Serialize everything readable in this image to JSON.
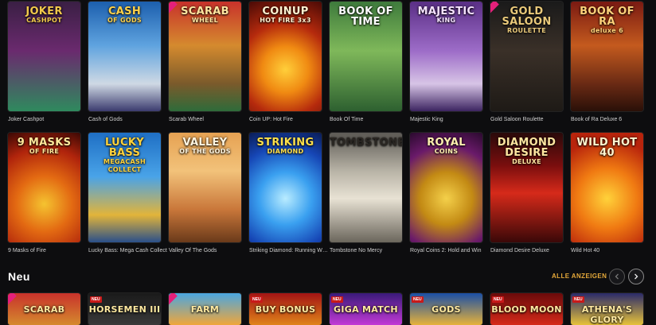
{
  "row1": [
    {
      "name": "Joker Cashpot",
      "logo": "JOKER",
      "sub": "CASHPOT",
      "badge": "",
      "bg": "linear-gradient(180deg,#3a1f44 0%,#6a2a6e 45%,#2f8a5e 100%)",
      "logo_color": "#f2c94c"
    },
    {
      "name": "Cash of Gods",
      "logo": "CASH",
      "sub": "OF GODS",
      "badge": "",
      "bg": "linear-gradient(180deg,#1c5fae 0%,#5fa3df 40%,#cfd9e4 75%,#3b3b6e 100%)",
      "logo_color": "#ffd24a"
    },
    {
      "name": "Scarab Wheel",
      "logo": "SCARAB",
      "sub": "WHEEL",
      "badge": "ribbon",
      "bg": "linear-gradient(180deg,#c8322b 0%,#d58a2e 40%,#7a5a2b 75%,#2e6b3a 100%)",
      "logo_color": "#ffe6a0"
    },
    {
      "name": "Coin UP: Hot Fire",
      "logo": "COINUP",
      "sub": "HOT FIRE 3x3",
      "badge": "",
      "bg": "radial-gradient(circle at 50% 62%,#ffcf3a 0%,#f08a12 30%,#b52a0d 60%,#4a0a06 100%)",
      "logo_color": "#fff1d0"
    },
    {
      "name": "Book Of Time",
      "logo": "BOOK OF TIME",
      "sub": "",
      "badge": "",
      "bg": "linear-gradient(180deg,#3e7a3c 0%,#7fb85a 45%,#2d6030 100%)",
      "logo_color": "#ffffff"
    },
    {
      "name": "Majestic King",
      "logo": "MAJESTIC",
      "sub": "KING",
      "badge": "",
      "bg": "linear-gradient(180deg,#5a2f86 0%,#9d6cc8 45%,#d7c4e6 75%,#3c2460 100%)",
      "logo_color": "#f5e2ff"
    },
    {
      "name": "Gold Saloon Roulette",
      "logo": "GOLD SALOON",
      "sub": "ROULETTE",
      "badge": "ribbon",
      "bg": "linear-gradient(180deg,#1a1a1a 0%,#3a3028 45%,#1e1a16 100%)",
      "logo_color": "#e9c97a"
    },
    {
      "name": "Book of Ra Deluxe 6",
      "logo": "BOOK OF RA",
      "sub": "deluxe 6",
      "badge": "",
      "bg": "linear-gradient(180deg,#7a1a12 0%,#c45a1e 40%,#6a2a14 75%,#2a1008 100%)",
      "logo_color": "#ffd27a"
    }
  ],
  "row2": [
    {
      "name": "9 Masks of Fire",
      "logo": "9 MASKS",
      "sub": "OF FIRE",
      "badge": "",
      "bg": "radial-gradient(circle at 50% 65%,#f5c330 0%,#e36a12 35%,#b0240c 70%,#3a0804 100%)",
      "logo_color": "#ffe89a"
    },
    {
      "name": "Lucky Bass: Mega Cash Collect",
      "logo": "LUCKY BASS",
      "sub": "MEGACASH COLLECT",
      "badge": "",
      "bg": "linear-gradient(180deg,#1f6fc4 0%,#49a3e8 40%,#e2b43a 75%,#2a4f8a 100%)",
      "logo_color": "#ffd23a"
    },
    {
      "name": "Valley Of The Gods",
      "logo": "VALLEY",
      "sub": "OF THE GODS",
      "badge": "",
      "bg": "linear-gradient(180deg,#e6a253 0%,#f2c27a 35%,#c9773a 70%,#6a3a1a 100%)",
      "logo_color": "#fff6e2"
    },
    {
      "name": "Striking Diamond: Running Wins",
      "logo": "STRIKING",
      "sub": "DIAMOND",
      "badge": "",
      "bg": "radial-gradient(circle at 50% 60%,#b9ecff 0%,#3aa0f0 35%,#1646b5 70%,#0a1c55 100%)",
      "logo_color": "#ffe04a"
    },
    {
      "name": "Tombstone No Mercy",
      "logo": "TOMBSTONE",
      "sub": "",
      "badge": "",
      "bg": "linear-gradient(180deg,#5d5a55 0%,#b8b3a6 35%,#e8e2d4 60%,#6b665c 100%)",
      "logo_color": "#2a2622"
    },
    {
      "name": "Royal Coins 2: Hold and Win",
      "logo": "ROYAL",
      "sub": "COINS",
      "badge": "",
      "bg": "radial-gradient(circle at 50% 60%,#f4d04a 0%,#c38a14 35%,#6a1a6a 70%,#2a0a2e 100%)",
      "logo_color": "#fff0b0"
    },
    {
      "name": "Diamond Desire Deluxe",
      "logo": "DIAMOND DESIRE",
      "sub": "DELUXE",
      "badge": "",
      "bg": "linear-gradient(180deg,#2a0a0a 0%,#7a0e0e 30%,#d62a1a 55%,#3a0808 100%)",
      "logo_color": "#ffe6a0"
    },
    {
      "name": "Wild Hot 40",
      "logo": "WILD HOT 40",
      "sub": "",
      "badge": "",
      "bg": "radial-gradient(circle at 50% 60%,#ffd23a 0%,#f07a12 40%,#b8240c 80%)",
      "logo_color": "#fff6d0"
    }
  ],
  "section": {
    "title": "Neu",
    "show_all": "ALLE ANZEIGEN"
  },
  "new_row": [
    {
      "logo": "SCARAB",
      "badge": "ribbon",
      "tag": "",
      "bg": "linear-gradient(180deg,#c8322b,#d58a2e)"
    },
    {
      "logo": "HORSEMEN III",
      "badge": "",
      "tag": "NEU",
      "bg": "linear-gradient(180deg,#1a1a1a,#3a3a3a)"
    },
    {
      "logo": "FARM",
      "badge": "ribbon",
      "tag": "",
      "bg": "linear-gradient(180deg,#4aa6e0,#f0a63a)"
    },
    {
      "logo": "BUY BONUS",
      "badge": "",
      "tag": "NEU",
      "bg": "linear-gradient(180deg,#a31414,#e0841a)"
    },
    {
      "logo": "GIGA MATCH",
      "badge": "",
      "tag": "NEU",
      "bg": "linear-gradient(180deg,#3a1a7a,#c23ad6)"
    },
    {
      "logo": "GODS",
      "badge": "",
      "tag": "NEU",
      "bg": "linear-gradient(180deg,#1a4fa6,#e6b23a)"
    },
    {
      "logo": "BLOOD MOON",
      "badge": "",
      "tag": "NEU",
      "bg": "linear-gradient(180deg,#6a0a0a,#d62a1a)"
    },
    {
      "logo": "ATHENA'S GLORY",
      "badge": "",
      "tag": "NEU",
      "bg": "linear-gradient(180deg,#2a2a6a,#e6c23a)"
    }
  ]
}
